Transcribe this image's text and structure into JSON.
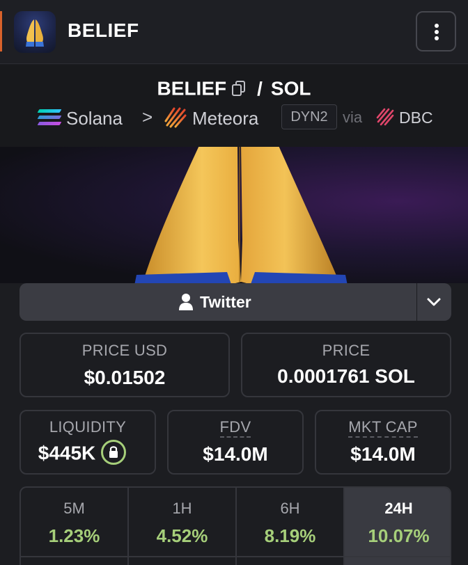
{
  "header": {
    "title": "BELIEF",
    "app_icon": "praying-hands-emoji",
    "menu_icon": "kebab-menu-icon"
  },
  "pair": {
    "base": "BELIEF",
    "separator": "/",
    "quote": "SOL",
    "chain": "Solana",
    "chevron": ">",
    "dex": "Meteora",
    "badge": "DYN2",
    "via": "via",
    "source": "DBC"
  },
  "social": {
    "label": "Twitter"
  },
  "metrics": {
    "price_usd_label": "PRICE USD",
    "price_usd_value": "$0.01502",
    "price_label": "PRICE",
    "price_value": "0.0001761 SOL",
    "liquidity_label": "LIQUIDITY",
    "liquidity_value": "$445K",
    "fdv_label": "FDV",
    "fdv_value": "$14.0M",
    "mktcap_label": "MKT CAP",
    "mktcap_value": "$14.0M"
  },
  "changes": [
    {
      "label": "5M",
      "value": "1.23%"
    },
    {
      "label": "1H",
      "value": "4.52%"
    },
    {
      "label": "6H",
      "value": "8.19%"
    },
    {
      "label": "24H",
      "value": "10.07%",
      "active": true
    }
  ],
  "colors": {
    "accent_green": "#a6cf7a",
    "accent_orange": "#d9622b",
    "background": "#1c1d21"
  }
}
